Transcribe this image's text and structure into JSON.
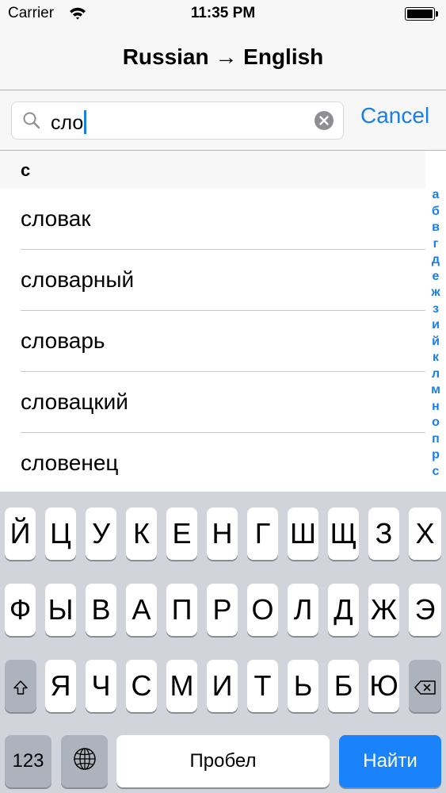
{
  "status": {
    "carrier": "Carrier",
    "time": "11:35 PM"
  },
  "nav": {
    "title": "Russian → English"
  },
  "search": {
    "value": "сло",
    "cancel_label": "Cancel"
  },
  "section": {
    "header": "с"
  },
  "results": [
    "словак",
    "словарный",
    "словарь",
    "словацкий",
    "словенец"
  ],
  "index_letters": [
    "а",
    "б",
    "в",
    "г",
    "д",
    "е",
    "ж",
    "з",
    "и",
    "й",
    "к",
    "л",
    "м",
    "н",
    "о",
    "п",
    "р",
    "с"
  ],
  "keyboard": {
    "row1": [
      "Й",
      "Ц",
      "У",
      "К",
      "Е",
      "Н",
      "Г",
      "Ш",
      "Щ",
      "З",
      "Х"
    ],
    "row2": [
      "Ф",
      "Ы",
      "В",
      "А",
      "П",
      "Р",
      "О",
      "Л",
      "Д",
      "Ж",
      "Э"
    ],
    "row3": [
      "Я",
      "Ч",
      "С",
      "М",
      "И",
      "Т",
      "Ь",
      "Б",
      "Ю"
    ],
    "numbers_label": "123",
    "space_label": "Пробел",
    "return_label": "Найти"
  }
}
